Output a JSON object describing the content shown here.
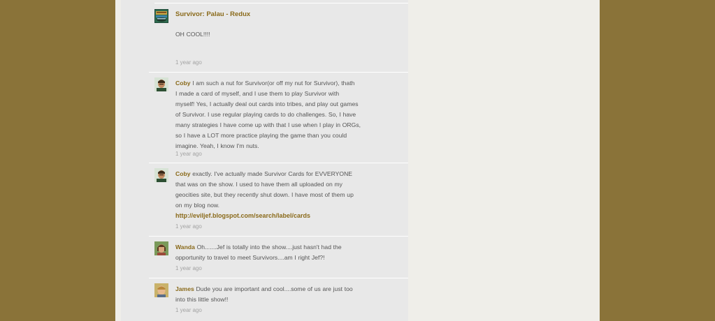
{
  "comments": [
    {
      "avatar_icon": "survivor-palau-logo-icon",
      "title": "Survivor: Palau - Redux",
      "text": "OH COOL!!!!",
      "time": "1 year ago"
    },
    {
      "avatar_icon": "user-avatar-coby-icon",
      "author": "Coby",
      "lines": [
        "I am such a nut for Survivor(or off my nut for Survivor), thath",
        "I made a card of myself, and I use them to play Survivor with",
        "myself!  Yes, I actually deal out cards into tribes, and play out games",
        "of Survivor.  I use regular playing cards to do challenges.  So, I have",
        "many strategies I have come up with that I use when I play in ORGs,",
        "so I have a LOT more practice playing the game than you could",
        "imagine.  Yeah, I know I'm nuts."
      ],
      "time": "1 year ago"
    },
    {
      "avatar_icon": "user-avatar-coby-icon",
      "author": "Coby",
      "lines": [
        "exactly.  I've actually made Survivor Cards for EVVERYONE",
        "that was on the show.  I used to have them all uploaded on my",
        "geocities site, but they recently shut down.  I have most of them up",
        "on my blog now."
      ],
      "link": "http://eviljef.blogspot.com/search/label/cards",
      "time": "1 year ago"
    },
    {
      "avatar_icon": "user-avatar-wanda-icon",
      "author": "Wanda",
      "lines": [
        "Oh.......Jef is totally into the show....just hasn't had the",
        "opportunity to travel to meet Survivors....am I right Jef?!"
      ],
      "time": "1 year ago"
    },
    {
      "avatar_icon": "user-avatar-james-icon",
      "author": "James",
      "lines": [
        "Dude you are important and cool....some of us are just too",
        "into this little show!!"
      ],
      "time": "1 year ago"
    }
  ]
}
